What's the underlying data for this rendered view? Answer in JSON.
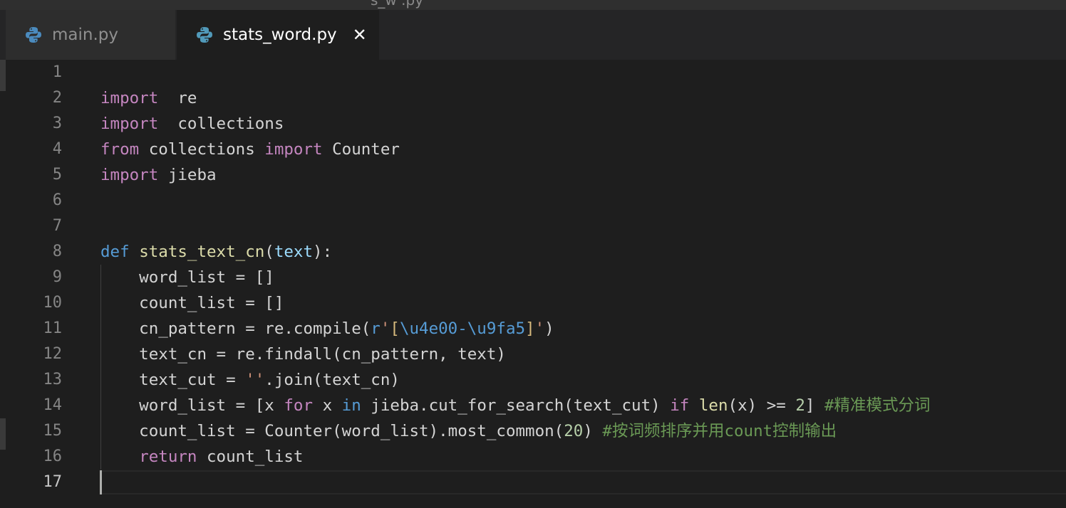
{
  "window": {
    "title_partial": "s_w     .py"
  },
  "tabs": [
    {
      "label": "main.py",
      "active": false,
      "icon": "python-icon"
    },
    {
      "label": "stats_word.py",
      "active": true,
      "icon": "python-icon",
      "close_glyph": "✕"
    }
  ],
  "editor": {
    "current_line": 17,
    "lines": [
      {
        "n": "1",
        "tokens": []
      },
      {
        "n": "2",
        "tokens": [
          [
            "kw",
            "import"
          ],
          [
            "",
            "  re"
          ]
        ]
      },
      {
        "n": "3",
        "tokens": [
          [
            "kw",
            "import"
          ],
          [
            "",
            "  collections"
          ]
        ]
      },
      {
        "n": "4",
        "tokens": [
          [
            "kw",
            "from"
          ],
          [
            "",
            " collections "
          ],
          [
            "kw",
            "import"
          ],
          [
            "",
            " Counter"
          ]
        ]
      },
      {
        "n": "5",
        "tokens": [
          [
            "kw",
            "import"
          ],
          [
            "",
            " jieba"
          ]
        ]
      },
      {
        "n": "6",
        "tokens": []
      },
      {
        "n": "7",
        "tokens": []
      },
      {
        "n": "8",
        "tokens": [
          [
            "def",
            "def"
          ],
          [
            "",
            " "
          ],
          [
            "fn",
            "stats_text_cn"
          ],
          [
            "",
            "("
          ],
          [
            "param",
            "text"
          ],
          [
            "",
            "):"
          ]
        ]
      },
      {
        "n": "9",
        "tokens": [
          [
            "",
            "    word_list = []"
          ]
        ]
      },
      {
        "n": "10",
        "tokens": [
          [
            "",
            "    count_list = []"
          ]
        ]
      },
      {
        "n": "11",
        "tokens": [
          [
            "",
            "    cn_pattern = re.compile("
          ],
          [
            "rx",
            "r"
          ],
          [
            "str",
            "'"
          ],
          [
            "esc",
            "["
          ],
          [
            "rx",
            "\\u4e00-\\u9fa5"
          ],
          [
            "esc",
            "]"
          ],
          [
            "str",
            "'"
          ],
          [
            "",
            ")"
          ]
        ]
      },
      {
        "n": "12",
        "tokens": [
          [
            "",
            "    text_cn = re.findall(cn_pattern, text)"
          ]
        ]
      },
      {
        "n": "13",
        "tokens": [
          [
            "",
            "    text_cut = "
          ],
          [
            "str",
            "''"
          ],
          [
            "",
            ".join(text_cn)"
          ]
        ]
      },
      {
        "n": "14",
        "tokens": [
          [
            "",
            "    word_list = [x "
          ],
          [
            "kw",
            "for"
          ],
          [
            "",
            " x "
          ],
          [
            "def",
            "in"
          ],
          [
            "",
            " jieba.cut_for_search(text_cut) "
          ],
          [
            "kw",
            "if"
          ],
          [
            "",
            " "
          ],
          [
            "fn",
            "len"
          ],
          [
            "",
            "(x) >= "
          ],
          [
            "num",
            "2"
          ],
          [
            "",
            "] "
          ],
          [
            "cm",
            "#精准模式分词"
          ]
        ]
      },
      {
        "n": "15",
        "tokens": [
          [
            "",
            "    count_list = Counter(word_list).most_common("
          ],
          [
            "num",
            "20"
          ],
          [
            "",
            ") "
          ],
          [
            "cm",
            "#按词频排序并用count控制输出"
          ]
        ]
      },
      {
        "n": "16",
        "tokens": [
          [
            "",
            "    "
          ],
          [
            "kw",
            "return"
          ],
          [
            "",
            " count_list"
          ]
        ]
      },
      {
        "n": "17",
        "tokens": []
      }
    ]
  },
  "colors": {
    "background": "#1e1e1e",
    "keyword": "#c586c0",
    "storage": "#569cd6",
    "function": "#dcdcaa",
    "parameter": "#9cdcfe",
    "string": "#ce9178",
    "number": "#b5cea8",
    "comment": "#6a9955"
  }
}
